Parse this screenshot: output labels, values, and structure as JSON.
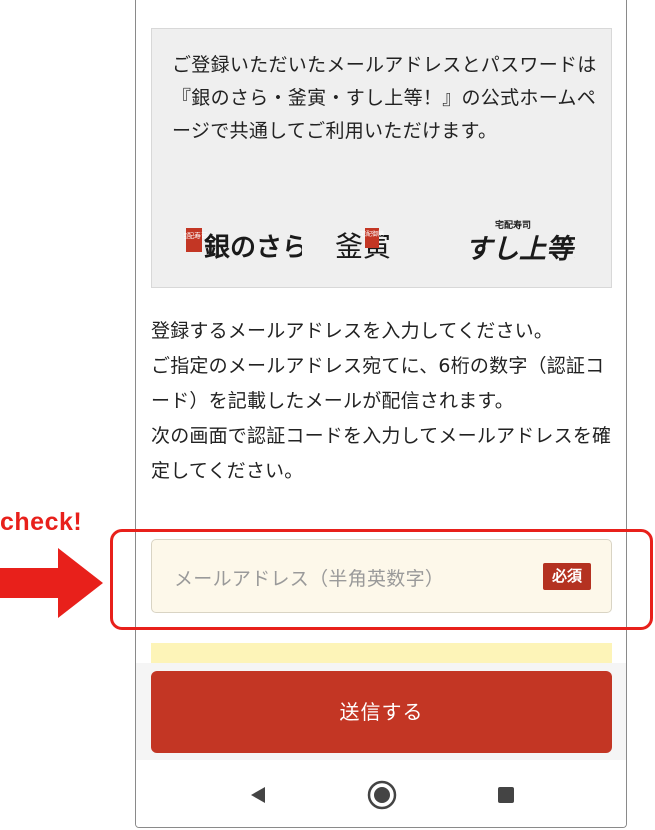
{
  "info": {
    "text": "ご登録いただいたメールアドレスとパスワードは『銀のさら・釜寅・すし上等！』の公式ホームページで共通してご利用いただけます。",
    "logos": [
      {
        "name": "ginnosara-logo",
        "text": "銀のさら",
        "sub": "宅配寿司"
      },
      {
        "name": "kamatora-logo",
        "text": "釜寅",
        "sub": "宅配御膳"
      },
      {
        "name": "sushijoto-logo",
        "text": "すし上等!",
        "sub": "宅配寿司"
      }
    ]
  },
  "instruction": {
    "lines": [
      "登録するメールアドレスを入力してください。",
      "ご指定のメールアドレス宛てに、6桁の数字（認証コード）を記載したメールが配信されます。",
      "次の画面で認証コードを入力してメールアドレスを確定してください。"
    ]
  },
  "email_field": {
    "placeholder": "メールアドレス（半角英数字）",
    "value": "",
    "required_label": "必須"
  },
  "submit": {
    "label": "送信する"
  },
  "annotation": {
    "check_label": "check!"
  },
  "colors": {
    "accent_red": "#c33624",
    "badge_red": "#b43221",
    "annotation_red": "#e8201b",
    "info_bg": "#efefef",
    "field_bg": "#fdf8ea"
  },
  "nav": {
    "icons": [
      "back-icon",
      "home-icon",
      "recents-icon"
    ]
  }
}
